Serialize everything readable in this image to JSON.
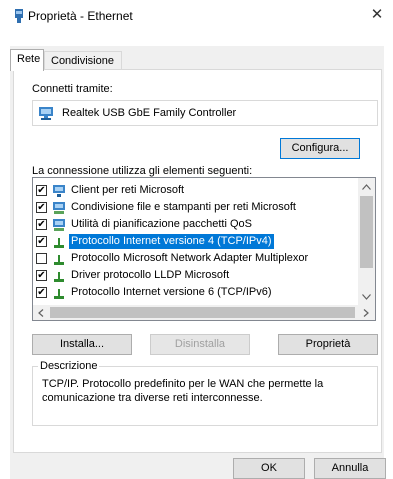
{
  "window": {
    "title": "Proprietà - Ethernet",
    "close_glyph": "✕"
  },
  "tabs": [
    {
      "label": "Rete",
      "active": true
    },
    {
      "label": "Condivisione",
      "active": false
    }
  ],
  "connect_using": {
    "label": "Connetti tramite:",
    "adapter": "Realtek USB GbE Family Controller",
    "configure_label": "Configura..."
  },
  "items_label": "La connessione utilizza gli elementi seguenti:",
  "items": [
    {
      "label": "Client per reti Microsoft",
      "checked": true,
      "icon": "network-client-icon",
      "selected": false
    },
    {
      "label": "Condivisione file e stampanti per reti Microsoft",
      "checked": true,
      "icon": "network-service-icon",
      "selected": false
    },
    {
      "label": "Utilità di pianificazione pacchetti QoS",
      "checked": true,
      "icon": "network-service-icon",
      "selected": false
    },
    {
      "label": "Protocollo Internet versione 4 (TCP/IPv4)",
      "checked": true,
      "icon": "protocol-icon",
      "selected": true
    },
    {
      "label": "Protocollo Microsoft Network Adapter Multiplexor",
      "checked": false,
      "icon": "protocol-icon",
      "selected": false
    },
    {
      "label": "Driver protocollo LLDP Microsoft",
      "checked": true,
      "icon": "protocol-icon",
      "selected": false
    },
    {
      "label": "Protocollo Internet versione 6 (TCP/IPv6)",
      "checked": true,
      "icon": "protocol-icon",
      "selected": false
    }
  ],
  "buttons": {
    "install": "Installa...",
    "uninstall": "Disinstalla",
    "properties": "Proprietà",
    "ok": "OK",
    "cancel": "Annulla"
  },
  "description": {
    "label": "Descrizione",
    "text_line1": "TCP/IP. Protocollo predefinito per le WAN che permette la",
    "text_line2": "comunicazione tra diverse reti interconnesse."
  },
  "colors": {
    "accent": "#0078d7",
    "dialog_bg": "#f0f0f0"
  }
}
